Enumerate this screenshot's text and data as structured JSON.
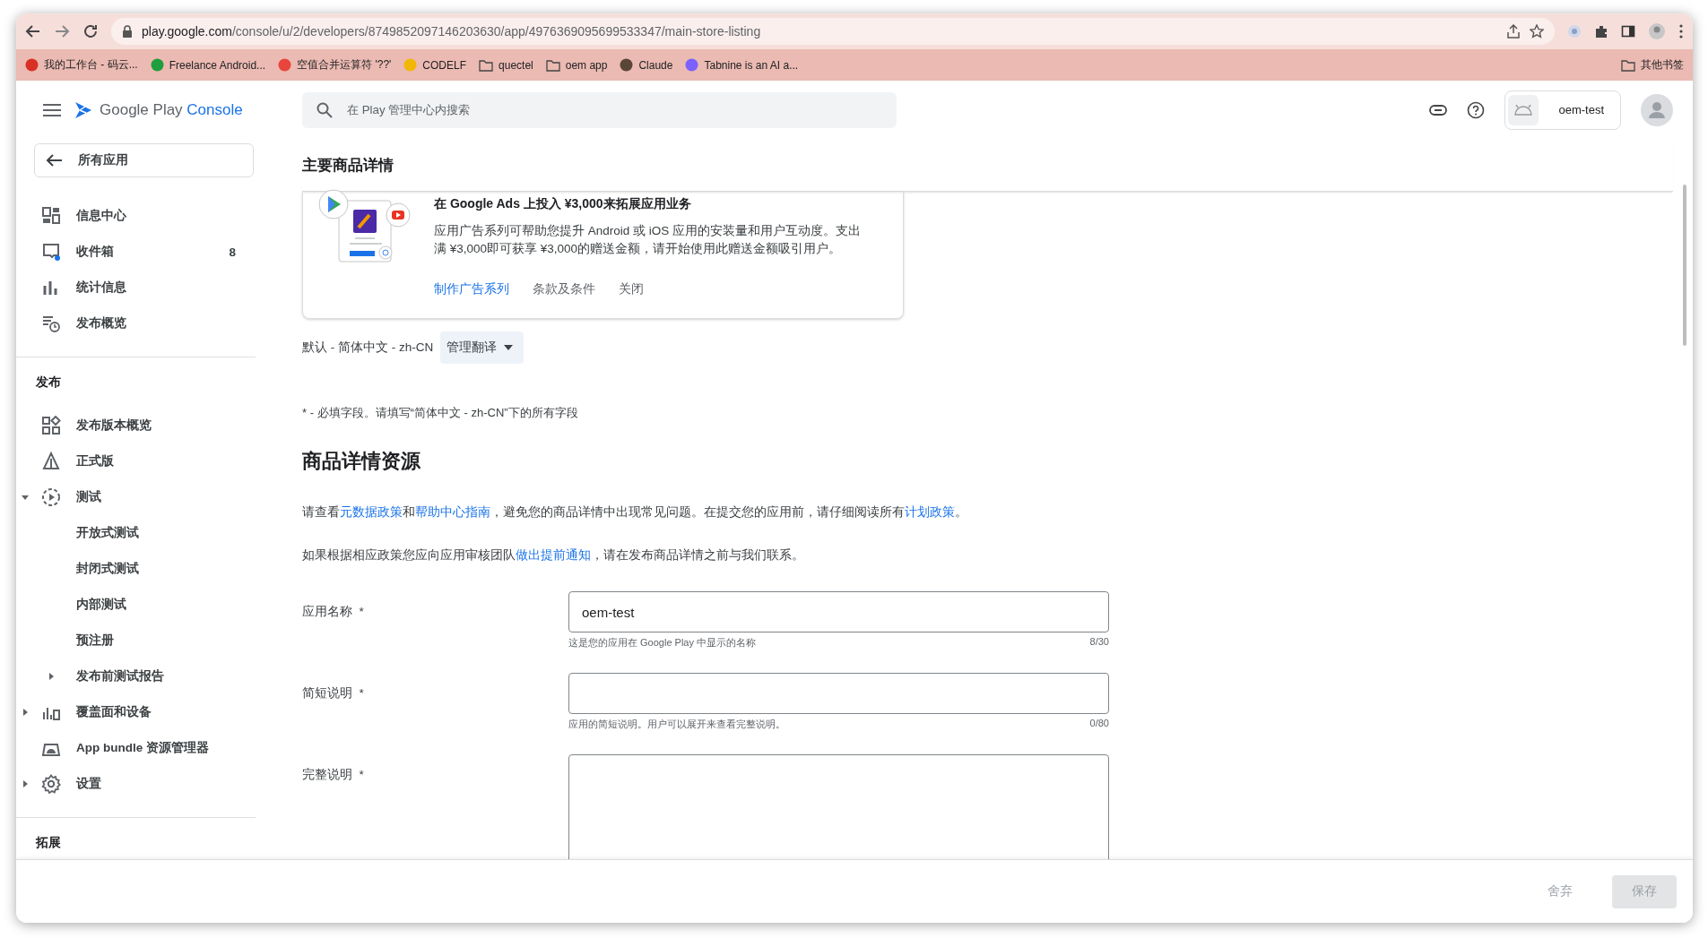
{
  "browser": {
    "url_host": "play.google.com",
    "url_path": "/console/u/2/developers/8749852097146203630/app/4976369095699533347/main-store-listing",
    "bookmarks": [
      {
        "label": "我的工作台 - 码云...",
        "kind": "site",
        "color": "#d93025"
      },
      {
        "label": "Freelance Android...",
        "kind": "site",
        "color": "#1e9e3e"
      },
      {
        "label": "空值合并运算符 '??'",
        "kind": "site",
        "color": "#e8453c"
      },
      {
        "label": "CODELF",
        "kind": "site",
        "color": "#f2b705"
      },
      {
        "label": "quectel",
        "kind": "folder"
      },
      {
        "label": "oem app",
        "kind": "folder"
      },
      {
        "label": "Claude",
        "kind": "site",
        "color": "#5a4636"
      },
      {
        "label": "Tabnine is an AI a...",
        "kind": "site",
        "color": "#7b61ff"
      }
    ],
    "other_bookmarks": "其他书签"
  },
  "header": {
    "brand": "Google Play",
    "product": "Console",
    "search_placeholder": "在 Play 管理中心内搜索",
    "account": "oem-test"
  },
  "sidebar": {
    "back": "所有应用",
    "sections": [
      {
        "items": [
          {
            "label": "信息中心"
          },
          {
            "label": "收件箱",
            "badge": "8"
          },
          {
            "label": "统计信息"
          },
          {
            "label": "发布概览"
          }
        ]
      },
      {
        "heading": "发布",
        "items": [
          {
            "label": "发布版本概览"
          },
          {
            "label": "正式版"
          },
          {
            "label": "测试",
            "expanded": true,
            "children": [
              {
                "label": "开放式测试"
              },
              {
                "label": "封闭式测试"
              },
              {
                "label": "内部测试"
              },
              {
                "label": "预注册"
              },
              {
                "label": "发布前测试报告",
                "expanded": false
              }
            ]
          },
          {
            "label": "覆盖面和设备",
            "expanded": false
          },
          {
            "label": "App bundle 资源管理器"
          },
          {
            "label": "设置",
            "expanded": false
          }
        ]
      },
      {
        "heading": "拓展"
      }
    ]
  },
  "page": {
    "title": "主要商品详情",
    "promo": {
      "title": "在 Google Ads 上投入 ¥3,000来拓展应用业务",
      "body": "应用广告系列可帮助您提升 Android 或 iOS 应用的安装量和用户互动度。支出满 ¥3,000即可获享 ¥3,000的赠送金额，请开始使用此赠送金额吸引用户。",
      "actions": [
        {
          "label": "制作广告系列",
          "kind": "link"
        },
        {
          "label": "条款及条件",
          "kind": "text"
        },
        {
          "label": "关闭",
          "kind": "text"
        }
      ]
    },
    "language": "默认 - 简体中文 - zh-CN",
    "manage_translations": "管理翻译",
    "required_note": "* - 必填字段。请填写“简体中文 - zh-CN”下的所有字段",
    "section_title": "商品详情资源",
    "paragraphs": [
      [
        {
          "kind": "text",
          "text": "请查看"
        },
        {
          "kind": "link",
          "text": "元数据政策"
        },
        {
          "kind": "text",
          "text": "和"
        },
        {
          "kind": "link",
          "text": "帮助中心指南"
        },
        {
          "kind": "text",
          "text": "，避免您的商品详情中出现常见问题。在提交您的应用前，请仔细阅读所有"
        },
        {
          "kind": "link",
          "text": "计划政策"
        },
        {
          "kind": "text",
          "text": "。"
        }
      ],
      [
        {
          "kind": "text",
          "text": "如果根据相应政策您应向应用审核团队"
        },
        {
          "kind": "link",
          "text": "做出提前通知"
        },
        {
          "kind": "text",
          "text": "，请在发布商品详情之前与我们联系。"
        }
      ]
    ],
    "fields": [
      {
        "label": "应用名称",
        "marker": "*",
        "kind": "input",
        "value": "oem-test",
        "hint": "这是您的应用在 Google Play 中显示的名称",
        "counter": "8/30"
      },
      {
        "label": "简短说明",
        "marker": "*",
        "kind": "input",
        "hint": "应用的简短说明。用户可以展开来查看完整说明。",
        "counter": "0/80"
      },
      {
        "label": "完整说明",
        "marker": "*",
        "kind": "textarea"
      }
    ]
  },
  "footer": {
    "buttons": [
      {
        "label": "舍弃",
        "kind": "text",
        "disabled": true
      },
      {
        "label": "保存",
        "kind": "filled",
        "disabled": true
      }
    ]
  }
}
